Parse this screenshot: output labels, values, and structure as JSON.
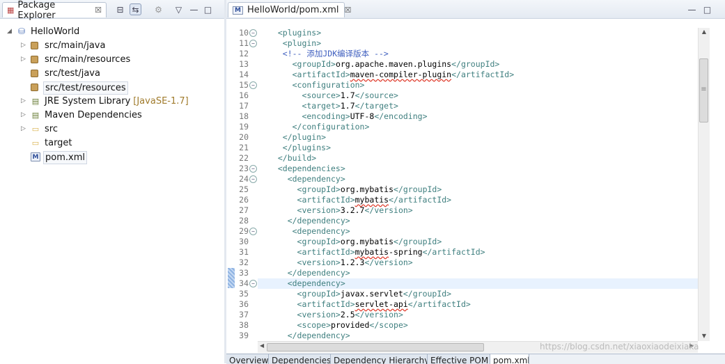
{
  "explorer": {
    "tab_title": "Package Explorer",
    "tab_close": "☒",
    "toolbar": {
      "collapse_all": "⊟",
      "link_editor": "⇆",
      "filter": "⚙",
      "view_menu": "▽",
      "minimize": "—",
      "maximize": "□"
    },
    "tree": [
      {
        "label": "HelloWorld",
        "indent": 0,
        "twisty": "expanded",
        "icon": "project"
      },
      {
        "label": "src/main/java",
        "indent": 1,
        "twisty": "collapsed",
        "icon": "package-folder"
      },
      {
        "label": "src/main/resources",
        "indent": 1,
        "twisty": "collapsed",
        "icon": "package-folder"
      },
      {
        "label": "src/test/java",
        "indent": 1,
        "twisty": "none",
        "icon": "package-folder"
      },
      {
        "label": "src/test/resources",
        "indent": 1,
        "twisty": "none",
        "icon": "package-folder",
        "selected": true
      },
      {
        "label": "JRE System Library",
        "decoration": "[JavaSE-1.7]",
        "indent": 1,
        "twisty": "collapsed",
        "icon": "library"
      },
      {
        "label": "Maven Dependencies",
        "indent": 1,
        "twisty": "collapsed",
        "icon": "library"
      },
      {
        "label": "src",
        "indent": 1,
        "twisty": "collapsed",
        "icon": "folder"
      },
      {
        "label": "target",
        "indent": 1,
        "twisty": "none",
        "icon": "folder"
      },
      {
        "label": "pom.xml",
        "indent": 1,
        "twisty": "none",
        "icon": "xml-file",
        "selected": true
      }
    ]
  },
  "editor": {
    "tab_title": "HelloWorld/pom.xml",
    "tab_icon": "M",
    "tab_close": "☒",
    "minimize": "—",
    "maximize": "□",
    "current_line": 34,
    "lines": [
      {
        "n": 10,
        "fold": true,
        "code": [
          [
            "t",
            "  <plugins>"
          ]
        ]
      },
      {
        "n": 11,
        "fold": true,
        "code": [
          [
            "t",
            "   <plugin>"
          ]
        ]
      },
      {
        "n": 12,
        "fold": false,
        "code": [
          [
            "cm",
            "   <!-- 添加JDK编译版本 -->"
          ]
        ]
      },
      {
        "n": 13,
        "fold": false,
        "code": [
          [
            "t",
            "     <groupId>"
          ],
          [
            "v",
            "org.apache.maven.plugins"
          ],
          [
            "t",
            "</groupId>"
          ]
        ]
      },
      {
        "n": 14,
        "fold": false,
        "code": [
          [
            "t",
            "     <artifactId>"
          ],
          [
            "vu",
            "maven-compiler-plugin"
          ],
          [
            "t",
            "</artifactId>"
          ]
        ]
      },
      {
        "n": 15,
        "fold": true,
        "code": [
          [
            "t",
            "     <configuration>"
          ]
        ]
      },
      {
        "n": 16,
        "fold": false,
        "code": [
          [
            "t",
            "       <source>"
          ],
          [
            "v",
            "1.7"
          ],
          [
            "t",
            "</source>"
          ]
        ]
      },
      {
        "n": 17,
        "fold": false,
        "code": [
          [
            "t",
            "       <target>"
          ],
          [
            "v",
            "1.7"
          ],
          [
            "t",
            "</target>"
          ]
        ]
      },
      {
        "n": 18,
        "fold": false,
        "code": [
          [
            "t",
            "       <encoding>"
          ],
          [
            "v",
            "UTF-8"
          ],
          [
            "t",
            "</encoding>"
          ]
        ]
      },
      {
        "n": 19,
        "fold": false,
        "code": [
          [
            "t",
            "     </configuration>"
          ]
        ]
      },
      {
        "n": 20,
        "fold": false,
        "code": [
          [
            "t",
            "   </plugin>"
          ]
        ]
      },
      {
        "n": 21,
        "fold": false,
        "code": [
          [
            "t",
            "   </plugins>"
          ]
        ]
      },
      {
        "n": 22,
        "fold": false,
        "code": [
          [
            "t",
            "  </build>"
          ]
        ]
      },
      {
        "n": 23,
        "fold": true,
        "code": [
          [
            "t",
            "  <dependencies>"
          ]
        ]
      },
      {
        "n": 24,
        "fold": true,
        "code": [
          [
            "t",
            "    <dependency>"
          ]
        ]
      },
      {
        "n": 25,
        "fold": false,
        "code": [
          [
            "t",
            "      <groupId>"
          ],
          [
            "v",
            "org.mybatis"
          ],
          [
            "t",
            "</groupId>"
          ]
        ]
      },
      {
        "n": 26,
        "fold": false,
        "code": [
          [
            "t",
            "      <artifactId>"
          ],
          [
            "vu",
            "mybatis"
          ],
          [
            "t",
            "</artifactId>"
          ]
        ]
      },
      {
        "n": 27,
        "fold": false,
        "code": [
          [
            "t",
            "      <version>"
          ],
          [
            "v",
            "3.2.7"
          ],
          [
            "t",
            "</version>"
          ]
        ]
      },
      {
        "n": 28,
        "fold": false,
        "code": [
          [
            "t",
            "    </dependency>"
          ]
        ]
      },
      {
        "n": 29,
        "fold": true,
        "code": [
          [
            "t",
            "     <dependency>"
          ]
        ]
      },
      {
        "n": 30,
        "fold": false,
        "code": [
          [
            "t",
            "      <groupId>"
          ],
          [
            "v",
            "org.mybatis"
          ],
          [
            "t",
            "</groupId>"
          ]
        ]
      },
      {
        "n": 31,
        "fold": false,
        "code": [
          [
            "t",
            "      <artifactId>"
          ],
          [
            "vu",
            "mybatis"
          ],
          [
            "v",
            "-spring"
          ],
          [
            "t",
            "</artifactId>"
          ]
        ]
      },
      {
        "n": 32,
        "fold": false,
        "code": [
          [
            "t",
            "      <version>"
          ],
          [
            "v",
            "1.2.3"
          ],
          [
            "t",
            "</version>"
          ]
        ]
      },
      {
        "n": 33,
        "fold": false,
        "code": [
          [
            "t",
            "    </dependency>"
          ]
        ]
      },
      {
        "n": 34,
        "fold": true,
        "code": [
          [
            "t",
            "    <dependency>"
          ]
        ]
      },
      {
        "n": 35,
        "fold": false,
        "code": [
          [
            "t",
            "      <groupId>"
          ],
          [
            "v",
            "javax.servlet"
          ],
          [
            "t",
            "</groupId>"
          ]
        ]
      },
      {
        "n": 36,
        "fold": false,
        "code": [
          [
            "t",
            "      <artifactId>"
          ],
          [
            "vu",
            "servlet-api"
          ],
          [
            "t",
            "</artifactId>"
          ]
        ]
      },
      {
        "n": 37,
        "fold": false,
        "code": [
          [
            "t",
            "      <version>"
          ],
          [
            "v",
            "2.5"
          ],
          [
            "t",
            "</version>"
          ]
        ]
      },
      {
        "n": 38,
        "fold": false,
        "code": [
          [
            "t",
            "      <scope>"
          ],
          [
            "v",
            "provided"
          ],
          [
            "t",
            "</scope>"
          ]
        ]
      },
      {
        "n": 39,
        "fold": false,
        "code": [
          [
            "t",
            "    </dependency>"
          ]
        ]
      }
    ]
  },
  "scroll": {
    "up": "▲",
    "down": "▼",
    "left": "◀",
    "right": "▶",
    "grip": "≡"
  },
  "bottom_tabs": [
    "Overview",
    "Dependencies",
    "Dependency Hierarchy",
    "Effective POM",
    "pom.xml"
  ],
  "active_bottom_tab": "pom.xml",
  "watermark": "https://blog.csdn.net/xiaoxiaodeixiaka",
  "colors": {
    "tag": "#3f7f7f",
    "comment": "#3f5fbf",
    "current_line": "#e8f2fe"
  }
}
